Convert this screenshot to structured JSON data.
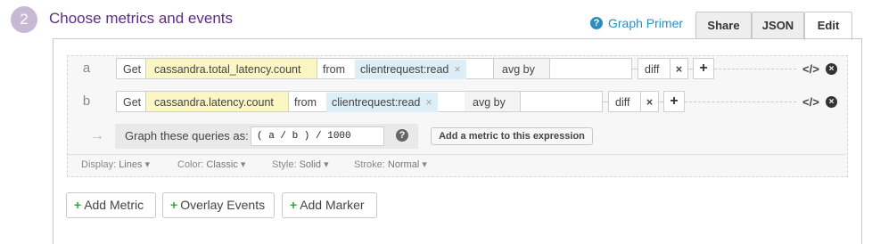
{
  "step": {
    "number": "2",
    "title": "Choose metrics and events"
  },
  "primer": {
    "label": "Graph Primer",
    "icon": "question-circle-icon",
    "color": "#2a8fc0"
  },
  "tabs": [
    {
      "label": "Share",
      "active": false
    },
    {
      "label": "JSON",
      "active": false
    },
    {
      "label": "Edit",
      "active": true
    }
  ],
  "queries": [
    {
      "letter": "a",
      "get_label": "Get",
      "metric": "cassandra.total_latency.count",
      "from_label": "from",
      "tag": "clientrequest:read",
      "agg_label": "avg by",
      "func": "diff"
    },
    {
      "letter": "b",
      "get_label": "Get",
      "metric": "cassandra.latency.count",
      "from_label": "from",
      "tag": "clientrequest:read",
      "agg_label": "avg by",
      "func": "diff"
    }
  ],
  "formula": {
    "label": "Graph these queries as:",
    "value": "( a / b ) / 1000",
    "add_metric_label": "Add a metric to this expression"
  },
  "options": {
    "display_label": "Display:",
    "display_value": "Lines",
    "color_label": "Color:",
    "color_value": "Classic",
    "style_label": "Style:",
    "style_value": "Solid",
    "stroke_label": "Stroke:",
    "stroke_value": "Normal"
  },
  "buttons": {
    "add_metric": "Add Metric",
    "overlay_events": "Overlay Events",
    "add_marker": "Add Marker"
  },
  "colors": {
    "accent_purple": "#5a2d82",
    "metric_highlight": "#fbf7c5",
    "tag_highlight": "#ddeef6",
    "plus_green": "#3aa53a"
  }
}
